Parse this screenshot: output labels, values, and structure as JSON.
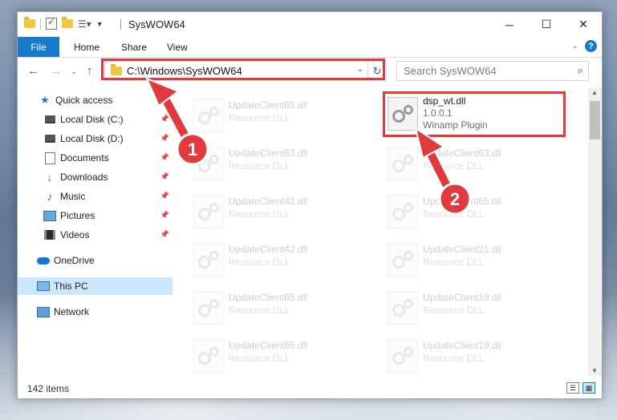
{
  "window": {
    "title": "SysWOW64",
    "controls": {
      "minimize": "─",
      "maximize": "☐",
      "close": "✕"
    }
  },
  "ribbon": {
    "tabs": [
      "File",
      "Home",
      "Share",
      "View"
    ],
    "help": "?"
  },
  "address": {
    "path": "C:\\Windows\\SysWOW64",
    "search_placeholder": "Search SysWOW64"
  },
  "nav": {
    "items": [
      {
        "label": "Quick access",
        "icon": "star-icon"
      },
      {
        "label": "Local Disk (C:)",
        "icon": "drive-icon",
        "pinned": true
      },
      {
        "label": "Local Disk (D:)",
        "icon": "drive-icon",
        "pinned": true
      },
      {
        "label": "Documents",
        "icon": "document-icon",
        "pinned": true
      },
      {
        "label": "Downloads",
        "icon": "download-icon",
        "pinned": true
      },
      {
        "label": "Music",
        "icon": "music-icon",
        "pinned": true
      },
      {
        "label": "Pictures",
        "icon": "pictures-icon",
        "pinned": true
      },
      {
        "label": "Videos",
        "icon": "videos-icon",
        "pinned": true
      },
      {
        "label": "OneDrive",
        "icon": "onedrive-icon"
      },
      {
        "label": "This PC",
        "icon": "this-pc-icon",
        "selected": true
      },
      {
        "label": "Network",
        "icon": "network-icon"
      }
    ]
  },
  "files": {
    "highlighted": {
      "name": "dsp_wt.dll",
      "version": "1.0.0.1",
      "desc": "Winamp Plugin"
    },
    "left_column": [
      {
        "name": "UpdateClient65.dll",
        "desc": "Resource DLL"
      },
      {
        "name": "UpdateClient63.dll",
        "desc": "Resource DLL"
      },
      {
        "name": "UpdateClient42.dll",
        "desc": "Resource DLL"
      },
      {
        "name": "UpdateClient42.dll",
        "desc": "Resource DLL"
      },
      {
        "name": "UpdateClient65.dll",
        "desc": "Resource DLL"
      },
      {
        "name": "UpdateClient65.dll",
        "desc": "Resource DLL"
      }
    ],
    "right_column": [
      {
        "name": "UpdateClient63.dll",
        "desc": "Resource DLL"
      },
      {
        "name": "UpdateClient65.dll",
        "desc": "Resource DLL"
      },
      {
        "name": "UpdateClient21.dll",
        "desc": "Resource DLL"
      },
      {
        "name": "UpdateClient19.dll",
        "desc": "Resource DLL"
      },
      {
        "name": "UpdateClient19.dll",
        "desc": "Resource DLL"
      }
    ]
  },
  "status": {
    "item_count": "142 items"
  },
  "annotations": {
    "step1": "1",
    "step2": "2",
    "color": "#e0393e"
  }
}
